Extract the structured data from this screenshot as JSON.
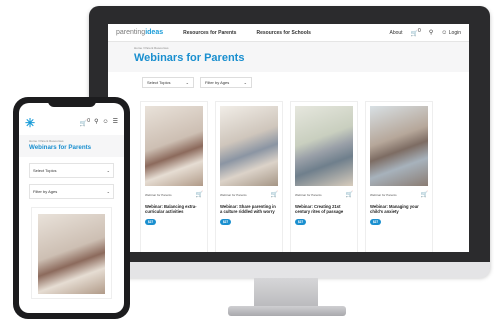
{
  "desktop": {
    "logo_main": "parenting",
    "logo_accent": "ideas",
    "nav": [
      "Resources for Parents",
      "Resources for Schools"
    ],
    "about": "About",
    "cart_count": "0",
    "login": "Login",
    "breadcrumb": "Home / Parent Resources",
    "title": "Webinars for Parents",
    "filter_topics": "Select Topics",
    "filter_ages": "Filter by Ages",
    "cards": [
      {
        "meta": "Webinar for Parents",
        "title": "Webinar: Balancing extra-curricular activities",
        "price": "$27"
      },
      {
        "meta": "Webinar for Parents",
        "title": "Webinar: Share parenting in a culture riddled with worry",
        "price": "$27"
      },
      {
        "meta": "Webinar for Parents",
        "title": "Webinar: Creating 21st century rites of passage",
        "price": "$27"
      },
      {
        "meta": "Webinar for Parents",
        "title": "Webinar: Managing your child's anxiety",
        "price": "$27"
      }
    ]
  },
  "mobile": {
    "breadcrumb": "Home / Parent Resources",
    "title": "Webinars for Parents",
    "filter_topics": "Select Topics",
    "filter_ages": "Filter by Ages",
    "cart_count": "0"
  },
  "colors": {
    "accent": "#1a8fcf",
    "frame": "#2b2b2d"
  }
}
